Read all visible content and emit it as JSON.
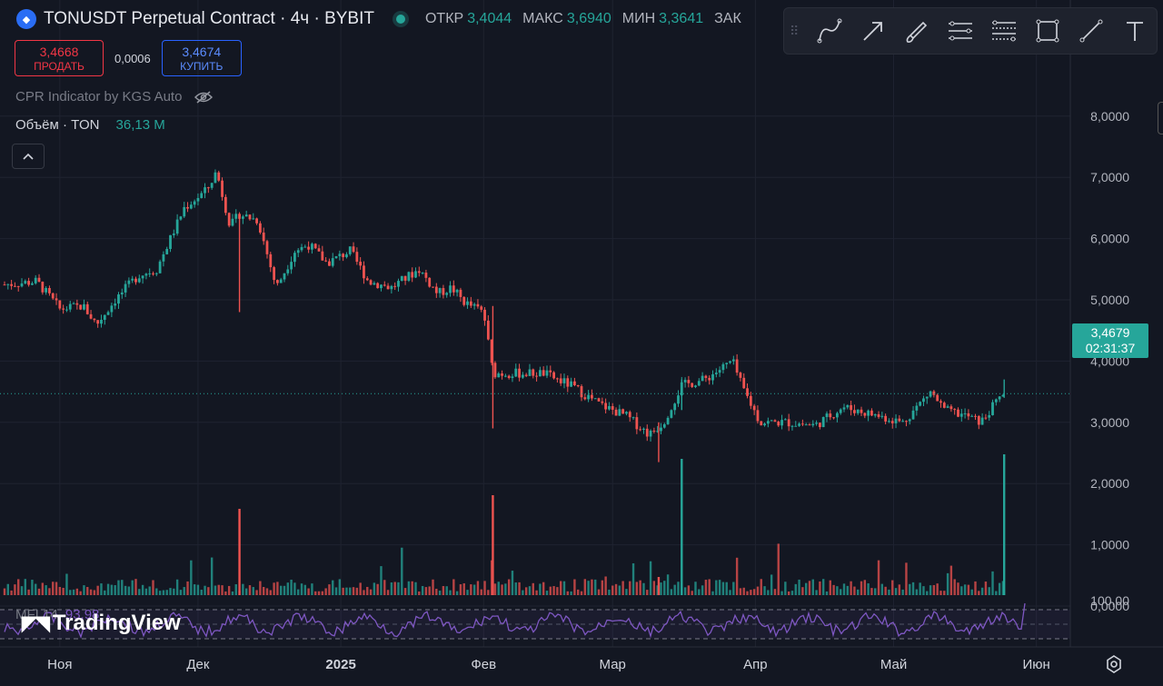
{
  "header": {
    "logo_icon": "ton-diamond-icon",
    "title": "TONUSDT Perpetual Contract · 4ч · BYBIT",
    "ohlc": [
      {
        "key": "ОТКР",
        "value": "3,4044"
      },
      {
        "key": "МАКС",
        "value": "3,6940"
      },
      {
        "key": "МИН",
        "value": "3,3641"
      },
      {
        "key": "ЗАК",
        "value": ""
      }
    ]
  },
  "trade": {
    "sell_price": "3,4668",
    "sell_label": "ПРОДАТЬ",
    "spread": "0,0006",
    "buy_price": "3,4674",
    "buy_label": "КУПИТЬ"
  },
  "indicators": {
    "cpr": "CPR Indicator by KGS Auto",
    "volume_label": "Объём · TON",
    "volume_value": "36,13 M",
    "collapse_icon": "chevron-up-icon",
    "mfi_label": "MFI 14",
    "mfi_value": "93,98"
  },
  "toolbar": {
    "tools": [
      "curve-tool-icon",
      "arrow-tool-icon",
      "brush-tool-icon",
      "parallel-channel-icon",
      "fib-retracement-icon",
      "rectangle-tool-icon",
      "trend-line-icon",
      "text-tool-icon"
    ]
  },
  "price_axis": {
    "labels": [
      "8,0000",
      "7,0000",
      "6,0000",
      "5,0000",
      "4,0000",
      "3,0000",
      "2,0000",
      "1,0000",
      "0,0000",
      "100,00"
    ]
  },
  "current_price": {
    "value": "3,4679",
    "countdown": "02:31:37"
  },
  "time_axis": {
    "labels": [
      "Ноя",
      "Дек",
      "2025",
      "Фев",
      "Мар",
      "Апр",
      "Май",
      "Июн"
    ]
  },
  "brand": {
    "name": "TradingView"
  },
  "colors": {
    "background": "#131722",
    "up": "#26a69a",
    "down": "#ef5350",
    "mfi": "#7e57c2",
    "sell": "#f23645",
    "buy": "#2962ff"
  },
  "chart_data": {
    "type": "candlestick",
    "symbol": "TONUSDT",
    "interval": "4h",
    "ylim": [
      2.0,
      8.0
    ],
    "price_path": [
      [
        "2024-10-20",
        5.25
      ],
      [
        "2024-10-27",
        5.3
      ],
      [
        "2024-11-01",
        4.85
      ],
      [
        "2024-11-06",
        4.9
      ],
      [
        "2024-11-09",
        4.6
      ],
      [
        "2024-11-13",
        5.0
      ],
      [
        "2024-11-18",
        5.4
      ],
      [
        "2024-11-22",
        5.5
      ],
      [
        "2024-11-28",
        6.5
      ],
      [
        "2024-12-03",
        6.8
      ],
      [
        "2024-12-05",
        7.1
      ],
      [
        "2024-12-08",
        6.2
      ],
      [
        "2024-12-10",
        6.4
      ],
      [
        "2024-12-14",
        6.3
      ],
      [
        "2024-12-18",
        5.2
      ],
      [
        "2024-12-22",
        5.8
      ],
      [
        "2024-12-25",
        5.9
      ],
      [
        "2024-12-29",
        5.6
      ],
      [
        "2025-01-03",
        5.8
      ],
      [
        "2025-01-07",
        5.3
      ],
      [
        "2025-01-12",
        5.2
      ],
      [
        "2025-01-18",
        5.5
      ],
      [
        "2025-01-22",
        5.1
      ],
      [
        "2025-01-25",
        5.2
      ],
      [
        "2025-01-28",
        4.95
      ],
      [
        "2025-02-01",
        4.8
      ],
      [
        "2025-02-03",
        3.8
      ],
      [
        "2025-02-08",
        3.8
      ],
      [
        "2025-02-14",
        3.8
      ],
      [
        "2025-02-20",
        3.6
      ],
      [
        "2025-02-26",
        3.3
      ],
      [
        "2025-03-04",
        3.1
      ],
      [
        "2025-03-09",
        2.8
      ],
      [
        "2025-03-12",
        3.0
      ],
      [
        "2025-03-16",
        3.6
      ],
      [
        "2025-03-21",
        3.7
      ],
      [
        "2025-03-27",
        4.0
      ],
      [
        "2025-03-29",
        3.6
      ],
      [
        "2025-04-02",
        3.0
      ],
      [
        "2025-04-08",
        3.0
      ],
      [
        "2025-04-14",
        2.95
      ],
      [
        "2025-04-20",
        3.25
      ],
      [
        "2025-04-28",
        3.1
      ],
      [
        "2025-05-03",
        3.0
      ],
      [
        "2025-05-09",
        3.5
      ],
      [
        "2025-05-12",
        3.2
      ],
      [
        "2025-05-17",
        3.1
      ],
      [
        "2025-05-20",
        3.0
      ],
      [
        "2025-05-24",
        3.4044
      ],
      [
        "2025-05-25",
        3.4679
      ]
    ]
  }
}
